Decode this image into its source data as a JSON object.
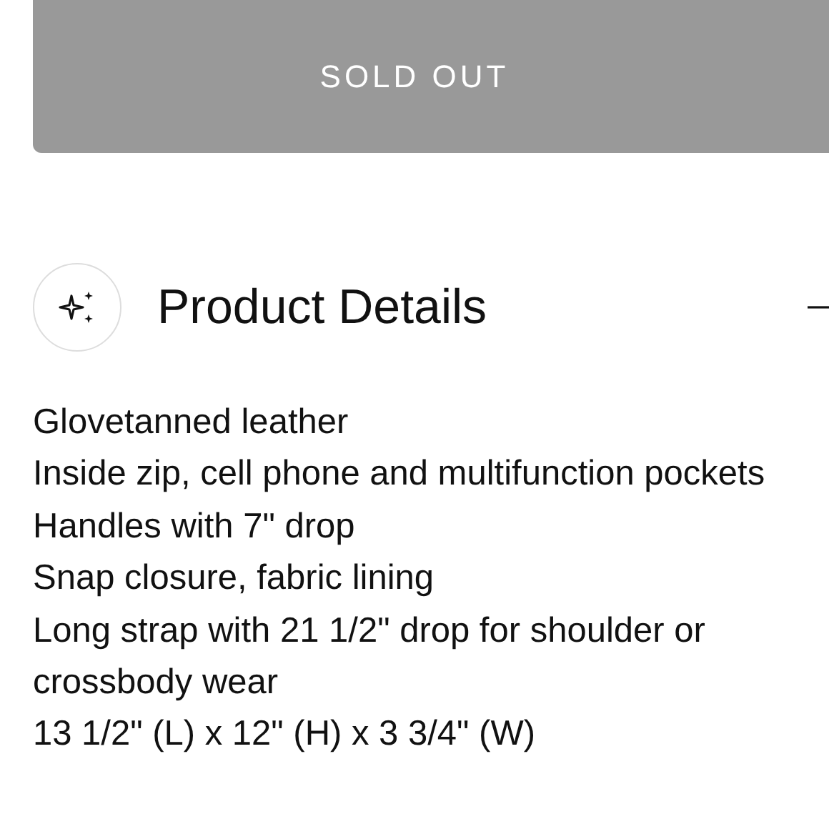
{
  "button": {
    "label": "SOLD OUT",
    "disabled": true
  },
  "section": {
    "title": "Product Details"
  },
  "details": [
    "Glovetanned leather",
    "Inside zip, cell phone and multifunction pockets",
    "Handles with 7\" drop",
    "Snap closure, fabric lining",
    "Long strap with 21 1/2\" drop for shoulder or crossbody wear",
    "13 1/2\" (L) x 12\" (H) x 3 3/4\" (W)"
  ]
}
